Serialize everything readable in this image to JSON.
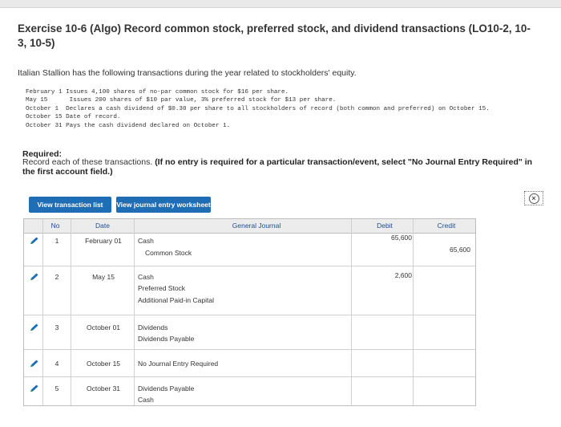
{
  "header": {
    "title": "Exercise 10-6 (Algo) Record common stock, preferred stock, and dividend transactions (LO10-2, 10-3, 10-5)"
  },
  "intro": "Italian Stallion has the following transactions during the year related to stockholders' equity.",
  "transactions": [
    "February 1 Issues 4,100 shares of no-par common stock for $16 per share.",
    "May 15      Issues 200 shares of $10 par value, 3% preferred stock for $13 per share.",
    "October 1  Declares a cash dividend of $0.30 per share to all stockholders of record (both common and preferred) on October 15.",
    "October 15 Date of record.",
    "October 31 Pays the cash dividend declared on October 1."
  ],
  "required": {
    "heading": "Required:",
    "text": "Record each of these transactions.",
    "bold_text": "(If no entry is required for a particular transaction/event, select \"No Journal Entry Required\" in the first account field.)"
  },
  "buttons": {
    "view_list": "View transaction list",
    "view_worksheet": "View journal entry worksheet"
  },
  "table": {
    "headers": {
      "no": "No",
      "date": "Date",
      "general_journal": "General Journal",
      "debit": "Debit",
      "credit": "Credit"
    },
    "entries": [
      {
        "no": "1",
        "date": "February 01",
        "lines": [
          {
            "account": "Cash",
            "debit": "65,600",
            "credit": ""
          },
          {
            "account": "Common Stock",
            "debit": "",
            "credit": "65,600"
          }
        ]
      },
      {
        "no": "2",
        "date": "May 15",
        "lines": [
          {
            "account": "Cash",
            "debit": "2,600",
            "credit": ""
          },
          {
            "account": "Preferred Stock",
            "debit": "",
            "credit": ""
          },
          {
            "account": "Additional Paid-in Capital",
            "debit": "",
            "credit": ""
          }
        ]
      },
      {
        "no": "3",
        "date": "October 01",
        "lines": [
          {
            "account": "Dividends",
            "debit": "",
            "credit": ""
          },
          {
            "account": "Dividends Payable",
            "debit": "",
            "credit": ""
          }
        ]
      },
      {
        "no": "4",
        "date": "October 15",
        "lines": [
          {
            "account": "No Journal Entry Required",
            "debit": "",
            "credit": ""
          }
        ]
      },
      {
        "no": "5",
        "date": "October 31",
        "lines": [
          {
            "account": "Dividends Payable",
            "debit": "",
            "credit": ""
          },
          {
            "account": "Cash",
            "debit": "",
            "credit": ""
          }
        ]
      }
    ]
  },
  "icons": {
    "edit": "pencil-icon",
    "close": "close-icon"
  },
  "colors": {
    "button": "#1f6db5",
    "header_text": "#1f4e8c",
    "pencil_blue": "#1f6db5",
    "pencil_green": "#3a9a3a"
  }
}
